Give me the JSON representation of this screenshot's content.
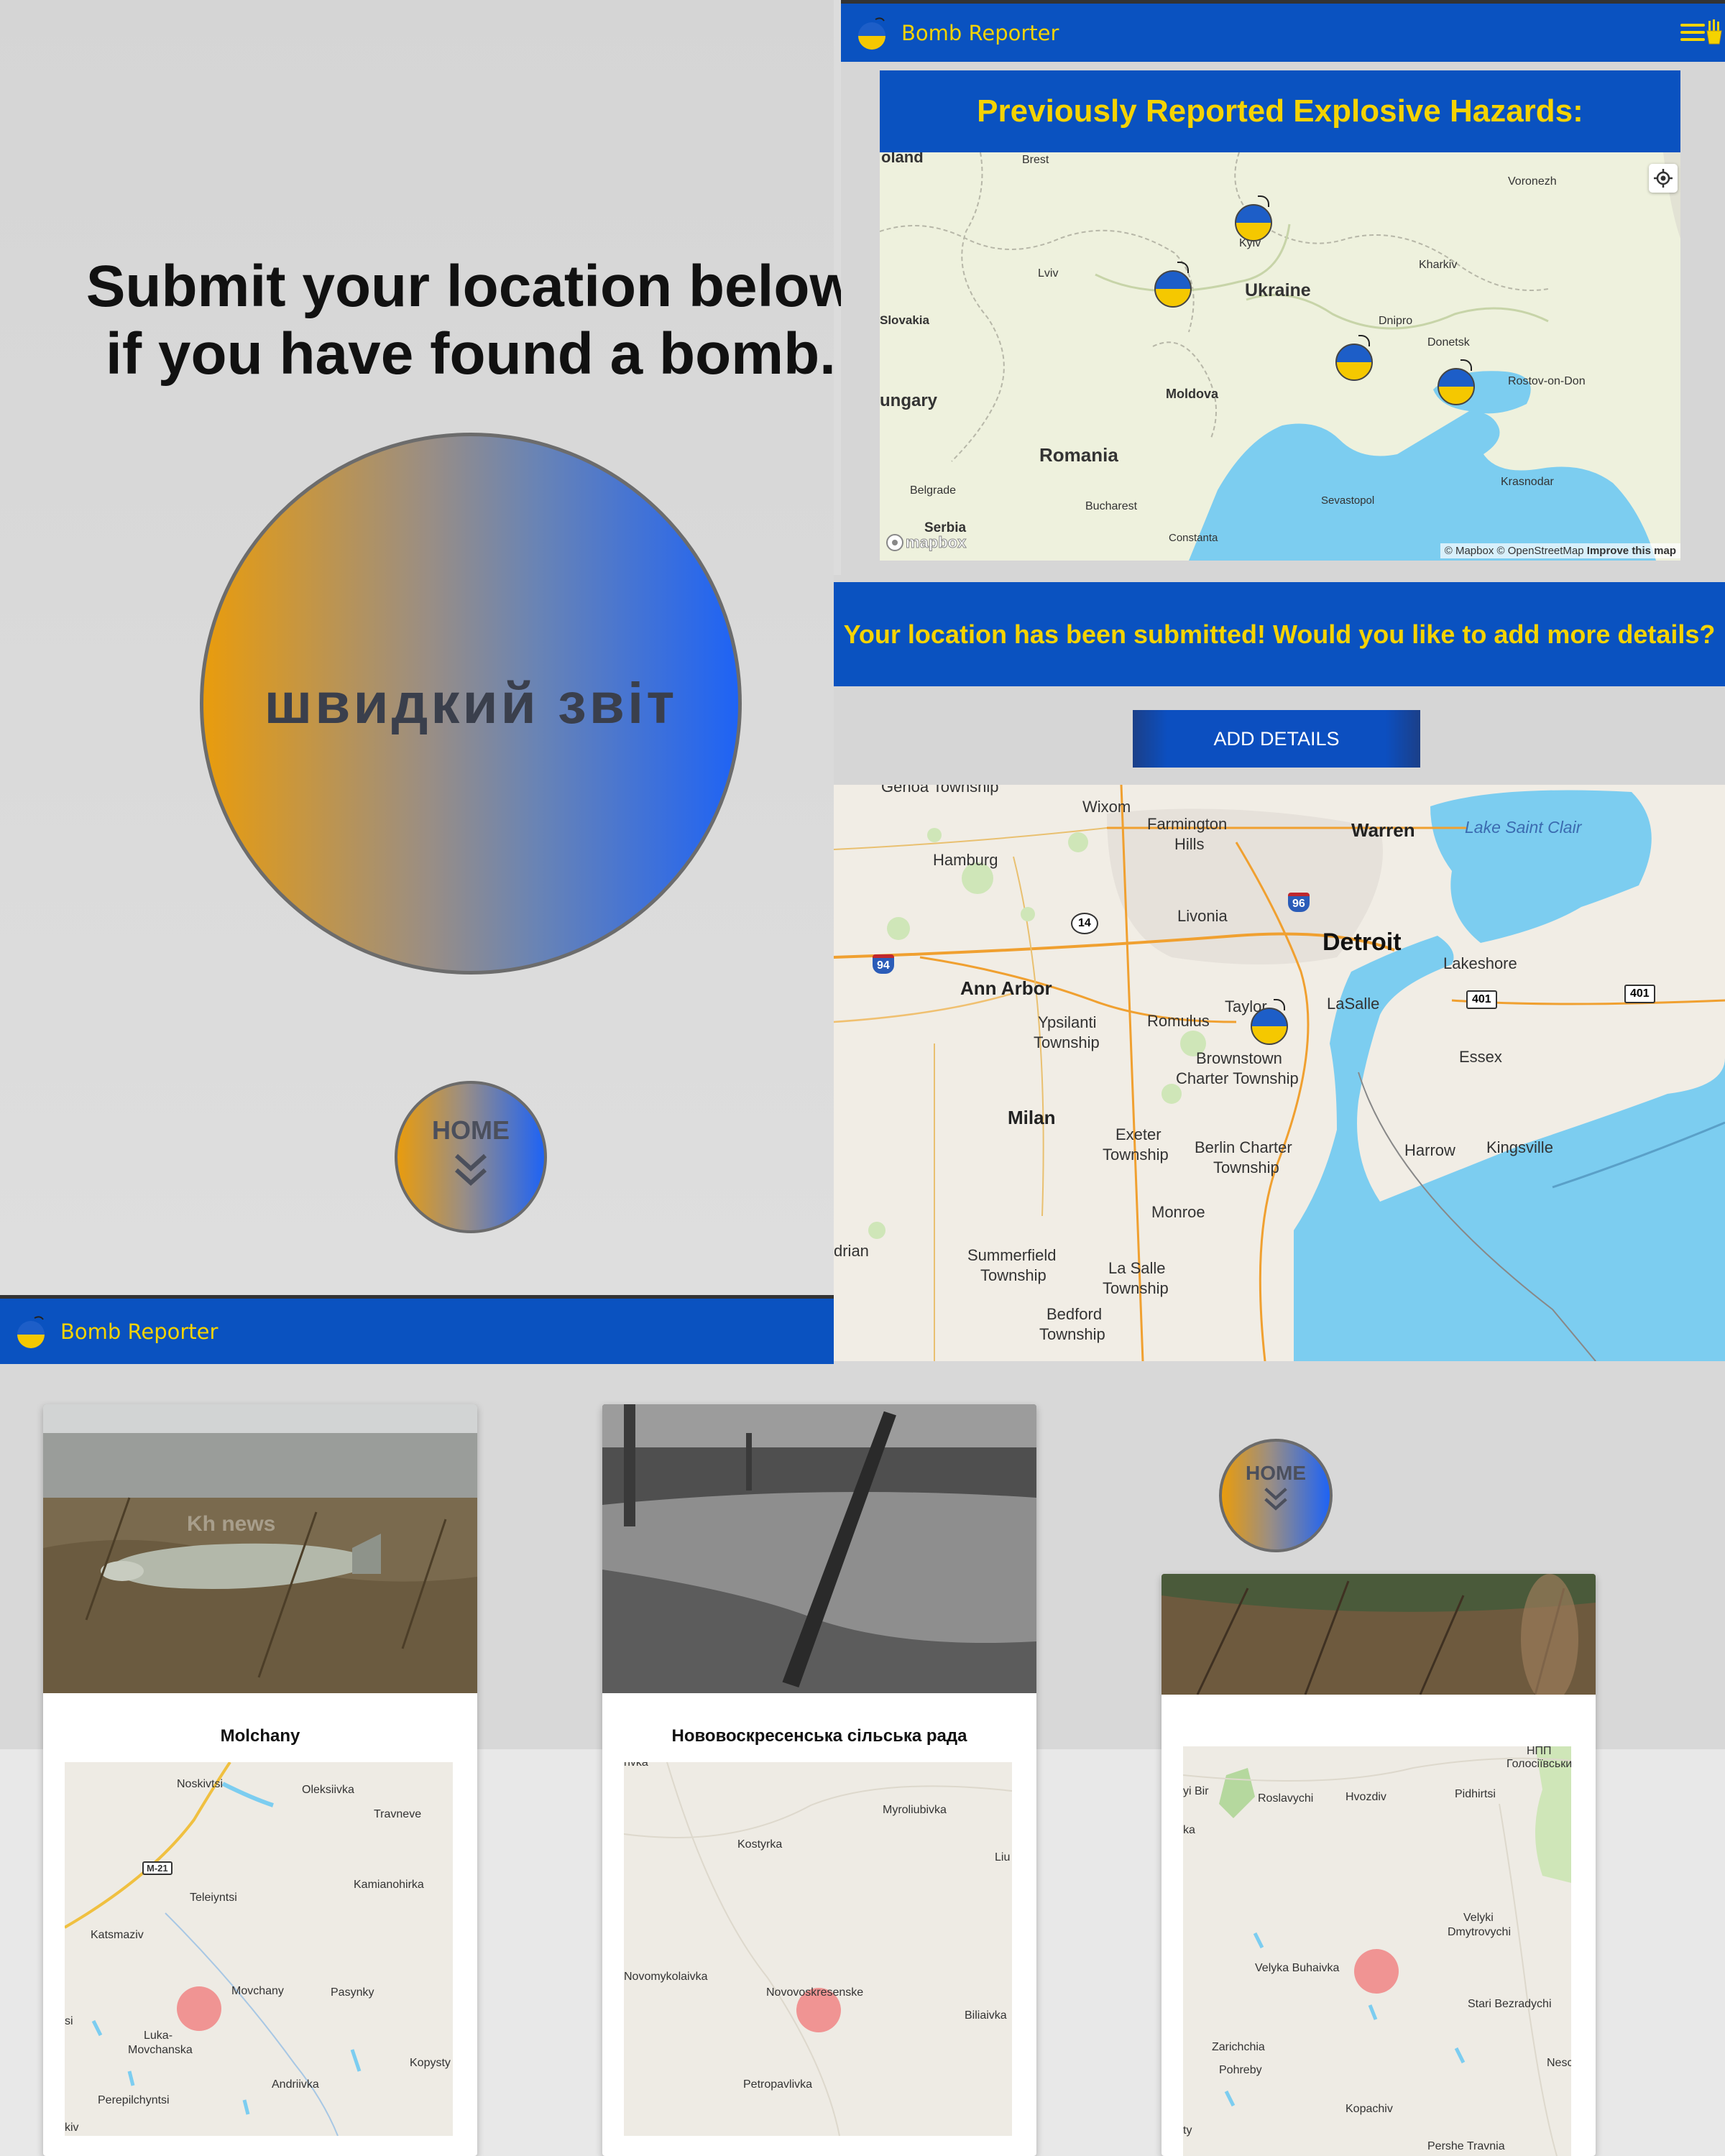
{
  "app": {
    "brand": "Bomb Reporter"
  },
  "quick_report": {
    "heading_line1": "Submit your location below",
    "heading_line2": "if you have found a bomb.",
    "button_label": "швидкий звіт",
    "home_label": "HOME"
  },
  "hazards": {
    "title": "Previously Reported Explosive Hazards:",
    "map_labels": {
      "poland": "oland",
      "brest": "Brest",
      "voronezh": "Voronezh",
      "kyiv": "Kyiv",
      "kharkiv": "Kharkiv",
      "lviv": "Lviv",
      "ukraine": "Ukraine",
      "slovakia": "Slovakia",
      "dnipro": "Dnipro",
      "donetsk": "Donetsk",
      "hungary": "ungary",
      "moldova": "Moldova",
      "rostov": "Rostov-on-Don",
      "romania": "Romania",
      "krasnodar": "Krasnodar",
      "belgrade": "Belgrade",
      "sevastopol": "Sevastopol",
      "bucharest": "Bucharest",
      "serbia": "Serbia",
      "constanta": "Constanta"
    },
    "mapbox_logo": "mapbox",
    "attribution": "© Mapbox © OpenStreetMap",
    "improve": "Improve this map"
  },
  "submission": {
    "banner": "Your location has been submitted! Would you like to add more details?",
    "add_details_label": "ADD DETAILS",
    "map_labels": {
      "genoa": "Genoa Township",
      "wixom": "Wixom",
      "farmington": "Farmington",
      "hills": "Hills",
      "warren": "Warren",
      "lake": "Lake Saint Clair",
      "hamburg": "Hamburg",
      "livonia": "Livonia",
      "detroit": "Detroit",
      "lakeshore": "Lakeshore",
      "annarbor": "Ann Arbor",
      "taylor": "Taylor",
      "lasalle": "LaSalle",
      "ypsilanti": "Ypsilanti",
      "ypsi_twp": "Township",
      "romulus": "Romulus",
      "brownstown": "Brownstown",
      "brownstown_twp": "Charter Township",
      "essex": "Essex",
      "milan": "Milan",
      "exeter": "Exeter",
      "exeter_twp": "Township",
      "berlin": "Berlin Charter",
      "berlin_twp": "Township",
      "harrow": "Harrow",
      "kingsville": "Kingsville",
      "monroe": "Monroe",
      "adrian": "drian",
      "summerfield": "Summerfield",
      "summerfield_twp": "Township",
      "lasalle_mi": "La Salle",
      "lasalle_twp": "Township",
      "bedford": "Bedford",
      "bedford_twp": "Township",
      "s14": "14",
      "s96": "96",
      "s94": "94",
      "s401a": "401",
      "s401b": "401"
    }
  },
  "reports": [
    {
      "title": "Molchany",
      "watermark": "Kh news",
      "map_labels": [
        "Noskivtsi",
        "Oleksiivka",
        "Travneve",
        "M-21",
        "Teleiyntsi",
        "Kamianohirka",
        "Katsmaziv",
        "Movchany",
        "Pasynky",
        "Luka-",
        "Movchanska",
        "Kopysty",
        "Andriivka",
        "Perepilchyntsi",
        "si",
        "kiv"
      ]
    },
    {
      "title": "Нововоскресенська сільська рада",
      "map_labels": [
        "Myroliubivka",
        "Kostyrka",
        "Liu",
        "Novomykolaivka",
        "Novovoskresenske",
        "Biliaivka",
        "Petropavlivka",
        "rivka"
      ]
    },
    {
      "title": "",
      "map_labels": [
        "НПП",
        "Голосіївськи",
        "yi Bir",
        "Roslavychi",
        "Hvozdiv",
        "Pidhirtsi",
        "ka",
        "Velyki",
        "Dmytrovychi",
        "Velyka Buhaivka",
        "Stari Bezradychi",
        "Zarichchia",
        "Pohreby",
        "Nesch",
        "Kopachiv",
        "Pershe Travnia",
        "ty"
      ]
    }
  ],
  "home2_label": "HOME",
  "colors": {
    "ukraine_blue": "#0a52c0",
    "ukraine_yellow": "#f5d300",
    "sea": "#7ccdf0",
    "marker_red": "#f08585"
  }
}
